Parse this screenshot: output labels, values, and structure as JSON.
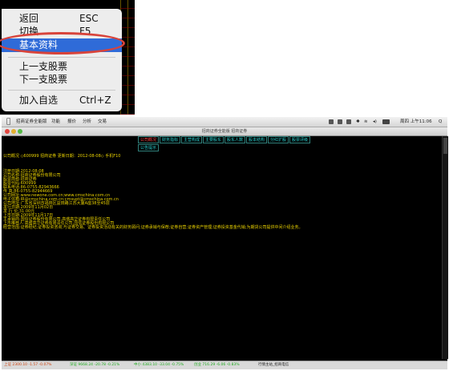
{
  "context_menu": {
    "items": [
      {
        "label": "返回",
        "shortcut": "ESC"
      },
      {
        "label": "切换",
        "shortcut": "F5"
      },
      {
        "label": "基本资料",
        "shortcut": ""
      },
      {
        "label": "上一支股票",
        "shortcut": ""
      },
      {
        "label": "下一支股票",
        "shortcut": ""
      },
      {
        "label": "加入自选",
        "shortcut": "Ctrl+Z"
      }
    ],
    "highlight_color": "#2f6bd8",
    "annotation_color": "#d8433a"
  },
  "menubar": {
    "apple": "",
    "items": [
      "招商证券全能版",
      "功能",
      "报价",
      "分析",
      "交易"
    ],
    "status_time": "周四 上午11:06",
    "search": "Q"
  },
  "window": {
    "title": "招商证券全能版 招商证券"
  },
  "tabs": [
    {
      "label": "公司概况",
      "active": true
    },
    {
      "label": "财务指标",
      "active": false
    },
    {
      "label": "主营构成",
      "active": false
    },
    {
      "label": "主要股东",
      "active": false
    },
    {
      "label": "股东人数",
      "active": false
    },
    {
      "label": "股本结构",
      "active": false
    },
    {
      "label": "分红扩股",
      "active": false
    },
    {
      "label": "股票评级",
      "active": false
    },
    {
      "label": "公告提示",
      "active": false
    }
  ],
  "content": {
    "header": "公司概况 ◇600999 招商证券 更新日期：2012-08-08◇ 手机F10",
    "lines": [
      "注册日期:2012-08-08",
      "公司名称:招商证券股份有限公司",
      "股票简称:招商证券",
      "股票代码:600999",
      "联系电话:86-0755-82943666",
      "传    真:86-0755-82944669",
      "公司网址:www.newone.com.cn;www.cmschina.com.cn",
      "电子信箱:IR@cmschina.com.cn;cmsupt@cmschina.com.cn",
      "公司地址:广东省深圳市福田区益田路江苏大厦A座38至45层",
      "发行日期:2009年11月02日",
      "发 行 价:31.00元",
      "上市日期:2009年11月17日",
      "主承销商:国信证券股份有限公司,高盛高华证券有限责任公司",
      "上市推荐人:高盛高华证券有限责任公司,国信证券股份有限公司",
      "经营范围:证券经纪;证券投资咨询;与证券交易、证券投资活动有关的财务顾问;证券承销与保荐;证券自营;证券资产管理;证券投资基金代销;为期货公司提供中间介绍业务。"
    ]
  },
  "statusbar": {
    "items": [
      "上证 2300.10 -1.57 -0.07%",
      "深证 9668.24 -20.78 -0.21%",
      "中小 4383.10 -33.04 -0.75%",
      "创业 716.29 -6.06 -0.83%",
      "行情主站_招商电信"
    ]
  }
}
